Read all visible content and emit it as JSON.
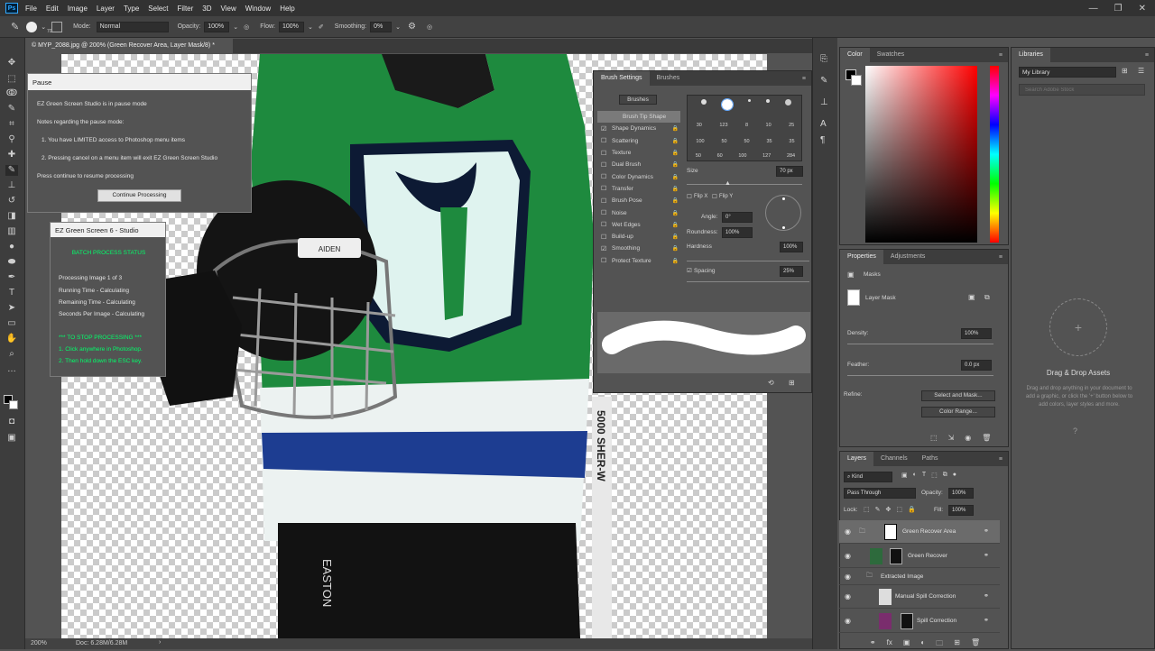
{
  "menu": {
    "app_icon": "Ps",
    "items": [
      "File",
      "Edit",
      "Image",
      "Layer",
      "Type",
      "Select",
      "Filter",
      "3D",
      "View",
      "Window",
      "Help"
    ],
    "window_controls": [
      "—",
      "❐",
      "✕"
    ]
  },
  "options_bar": {
    "brush_size": "70",
    "mode_label": "Mode:",
    "mode_value": "Normal",
    "opacity_label": "Opacity:",
    "opacity_value": "100%",
    "flow_label": "Flow:",
    "flow_value": "100%",
    "smoothing_label": "Smoothing:",
    "smoothing_value": "0%"
  },
  "document": {
    "tab_title": "© MYP_2088.jpg @ 200% (Green Recover Area, Layer Mask/8) *",
    "zoom": "200%",
    "doc_info": "Doc: 6.28M/6.28M"
  },
  "canvas_art": {
    "helmet_tag": "AIDEN",
    "stick_text": "5000 SHER-W",
    "pants_text": "EASTON"
  },
  "pause_dialog": {
    "title": "Pause",
    "line1": "EZ Green Screen Studio is in pause mode",
    "line2": "Notes regarding the pause mode:",
    "line3": "1. You have LIMITED access to Photoshop menu items",
    "line4": "2. Pressing cancel on a menu item will exit EZ Green Screen Studio",
    "line5": "Press continue to resume processing",
    "button": "Continue Processing"
  },
  "batch_panel": {
    "title": "EZ Green Screen 6 - Studio",
    "heading": "BATCH PROCESS STATUS",
    "status1": "Processing Image 1 of 3",
    "status2": "Running Time - Calculating",
    "status3": "Remaining Time - Calculating",
    "status4": "Seconds Per Image - Calculating",
    "stop_heading": "*** TO STOP PROCESSING ***",
    "stop1": "1. Click anywhere in Photoshop.",
    "stop2": "2. Then hold down the ESC key."
  },
  "brush_settings": {
    "tab_active": "Brush Settings",
    "tab2": "Brushes",
    "brushes_button": "Brushes",
    "items": [
      {
        "label": "Brush Tip Shape",
        "checked": false
      },
      {
        "label": "Shape Dynamics",
        "checked": true
      },
      {
        "label": "Scattering",
        "checked": false
      },
      {
        "label": "Texture",
        "checked": false
      },
      {
        "label": "Dual Brush",
        "checked": false
      },
      {
        "label": "Color Dynamics",
        "checked": false
      },
      {
        "label": "Transfer",
        "checked": false
      },
      {
        "label": "Brush Pose",
        "checked": false
      },
      {
        "label": "Noise",
        "checked": false
      },
      {
        "label": "Wet Edges",
        "checked": false
      },
      {
        "label": "Build-up",
        "checked": false
      },
      {
        "label": "Smoothing",
        "checked": true
      },
      {
        "label": "Protect Texture",
        "checked": false
      }
    ],
    "tip_sizes_row1": [
      "30",
      "123",
      "8",
      "10",
      "25"
    ],
    "tip_sizes_row2": [
      "100",
      "50",
      "50",
      "35",
      "35"
    ],
    "tip_sizes_row3": [
      "50",
      "60",
      "100",
      "127",
      "284"
    ],
    "size_label": "Size",
    "size_value": "70 px",
    "flip_x": "Flip X",
    "flip_y": "Flip Y",
    "angle_label": "Angle:",
    "angle_value": "0°",
    "roundness_label": "Roundness:",
    "roundness_value": "100%",
    "hardness_label": "Hardness",
    "hardness_value": "100%",
    "spacing_label": "Spacing",
    "spacing_value": "25%"
  },
  "color_panel": {
    "tab_active": "Color",
    "tab2": "Swatches"
  },
  "libraries": {
    "title": "Libraries",
    "library_select": "My Library",
    "search_placeholder": "Search Adobe Stock",
    "drop_title": "Drag & Drop Assets",
    "drop_text": "Drag and drop anything in your document to add a graphic, or click the '+' button below to add colors, layer styles and more."
  },
  "properties": {
    "tab_active": "Properties",
    "tab2": "Adjustments",
    "masks_label": "Masks",
    "layer_mask_label": "Layer Mask",
    "density_label": "Density:",
    "density_value": "100%",
    "feather_label": "Feather:",
    "feather_value": "0.0 px",
    "refine_label": "Refine:",
    "select_mask_button": "Select and Mask...",
    "color_range_button": "Color Range..."
  },
  "layers": {
    "tab_active": "Layers",
    "tab2": "Channels",
    "tab3": "Paths",
    "filter_kind": "Kind",
    "blend_mode": "Pass Through",
    "opacity_label": "Opacity:",
    "opacity_value": "100%",
    "lock_label": "Lock:",
    "fill_label": "Fill:",
    "fill_value": "100%",
    "rows": [
      {
        "name": "Green Recover Area",
        "type": "group-mask"
      },
      {
        "name": "Green Recover",
        "type": "layer-mask"
      },
      {
        "name": "Extracted Image",
        "type": "group"
      },
      {
        "name": "Manual Spill Correction",
        "type": "layer"
      },
      {
        "name": "Spill Correction",
        "type": "layer-mask"
      }
    ]
  }
}
